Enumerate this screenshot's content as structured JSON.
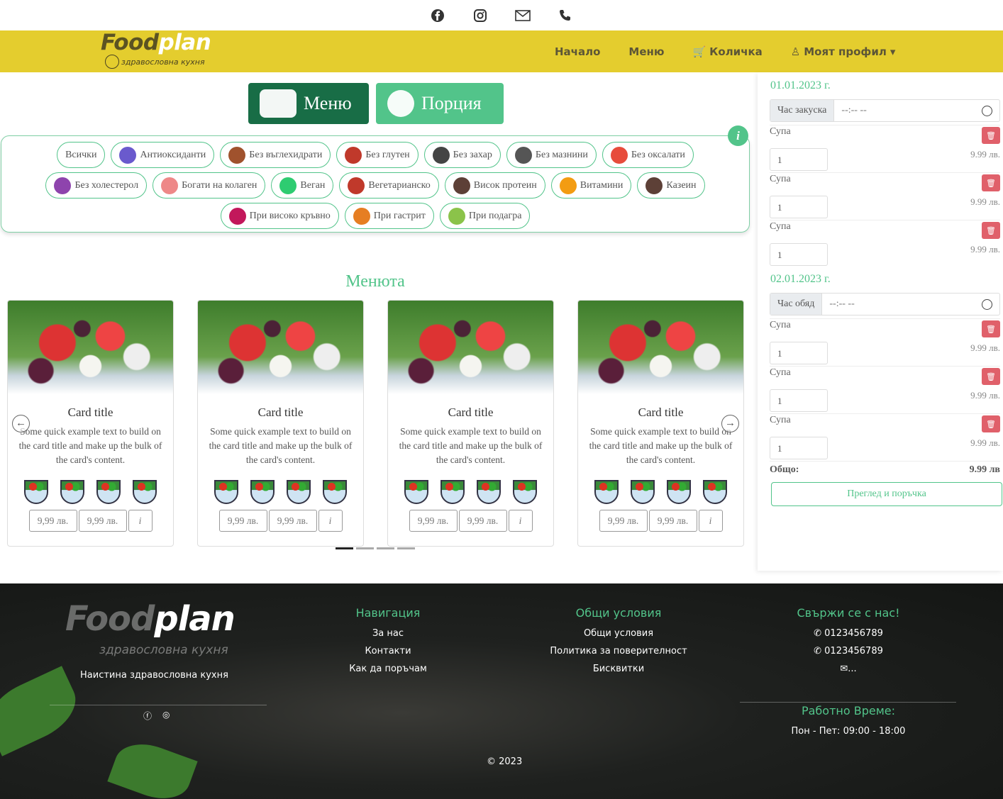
{
  "topbar": {
    "icons": [
      "facebook-icon",
      "instagram-icon",
      "mail-icon",
      "phone-icon"
    ]
  },
  "nav": {
    "logo_a": "Food",
    "logo_b": "plan",
    "logo_tag": "здравословна кухня",
    "links": {
      "home": "Начало",
      "menu": "Меню",
      "cart": "Количка",
      "profile": "Моят профил"
    }
  },
  "main_buttons": {
    "menu": "Меню",
    "portion": "Порция"
  },
  "filters": [
    "Всички",
    "Антиоксиданти",
    "Без въглехидрати",
    "Без глутен",
    "Без захар",
    "Без мазнини",
    "Без оксалати",
    "Без холестерол",
    "Богати на колаген",
    "Веган",
    "Вегетарианско",
    "Висок протеин",
    "Витамини",
    "Казеин",
    "При високо кръвно",
    "При гастрит",
    "При подагра"
  ],
  "filter_info": "i",
  "section_title": "Менюта",
  "cards": [
    {
      "title": "Card title",
      "text": "Some quick example text to build on the card title and make up the bulk of the card's content.",
      "price1": "9,99 лв.",
      "price2": "9,99 лв.",
      "info": "i"
    },
    {
      "title": "Card title",
      "text": "Some quick example text to build on the card title and make up the bulk of the card's content.",
      "price1": "9,99 лв.",
      "price2": "9,99 лв.",
      "info": "i"
    },
    {
      "title": "Card title",
      "text": "Some quick example text to build on the card title and make up the bulk of the card's content.",
      "price1": "9,99 лв.",
      "price2": "9,99 лв.",
      "info": "i"
    },
    {
      "title": "Card title",
      "text": "Some quick example text to build on the card title and make up the bulk of the card's content.",
      "price1": "9,99 лв.",
      "price2": "9,99 лв.",
      "info": "i"
    }
  ],
  "cart": {
    "days": [
      {
        "date": "01.01.2023 г.",
        "time_label": "Час закуска",
        "time_value": "--:-- --",
        "items": [
          {
            "name": "Супа",
            "qty": "1",
            "price": "9.99 лв."
          },
          {
            "name": "Супа",
            "qty": "1",
            "price": "9.99 лв."
          },
          {
            "name": "Супа",
            "qty": "1",
            "price": "9.99 лв."
          }
        ]
      },
      {
        "date": "02.01.2023 г.",
        "time_label": "Час обяд",
        "time_value": "--:-- --",
        "items": [
          {
            "name": "Супа",
            "qty": "1",
            "price": "9.99 лв."
          },
          {
            "name": "Супа",
            "qty": "1",
            "price": "9.99 лв."
          },
          {
            "name": "Супа",
            "qty": "1",
            "price": "9.99 лв."
          }
        ]
      }
    ],
    "total_label": "Общо:",
    "total_value": "9.99 лв",
    "order_button": "Преглед и поръчка"
  },
  "footer": {
    "logo_a": "Food",
    "logo_b": "plan",
    "logo_tag": "здравословна кухня",
    "motto": "Наистина здравословна кухня",
    "nav_title": "Навигация",
    "nav_links": [
      "За нас",
      "Контакти",
      "Как да поръчам"
    ],
    "terms_title": "Общи условия",
    "terms_links": [
      "Общи условия",
      "Политика за поверителност",
      "Бисквитки"
    ],
    "contact_title": "Свържи се с нас!",
    "phones": [
      "0123456789",
      "0123456789"
    ],
    "email": "✉...",
    "hours_title": "Работно Време:",
    "hours": "Пон - Пет: 09:00 - 18:00",
    "copyright": "© 2023"
  },
  "colors": {
    "nav_bg": "#e4cd2e",
    "accent": "#52c48a",
    "dark_green": "#186d46",
    "delete": "#e0606a"
  }
}
